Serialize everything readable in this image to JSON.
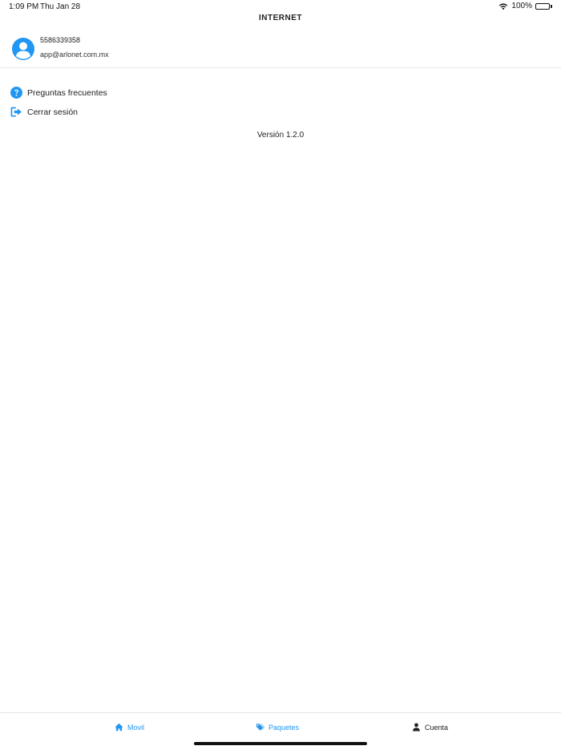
{
  "status_bar": {
    "time": "1:09 PM",
    "date": "Thu Jan 28",
    "battery": "100%"
  },
  "header": {
    "title": "INTERNET"
  },
  "profile": {
    "phone": "5586339358",
    "email": "app@arlonet.com.mx"
  },
  "menu": {
    "faq_label": "Preguntas frecuentes",
    "logout_label": "Cerrar sesión"
  },
  "version": "Versión 1.2.0",
  "tabs": {
    "movil": "Movil",
    "paquetes": "Paquetes",
    "cuenta": "Cuenta"
  },
  "colors": {
    "accent": "#2196f3",
    "text": "#222222",
    "divider": "#e6e6e6"
  },
  "icons": {
    "faq": "question-circle-icon",
    "logout": "sign-out-icon",
    "movil": "home-icon",
    "paquetes": "tags-icon",
    "cuenta": "user-icon"
  }
}
